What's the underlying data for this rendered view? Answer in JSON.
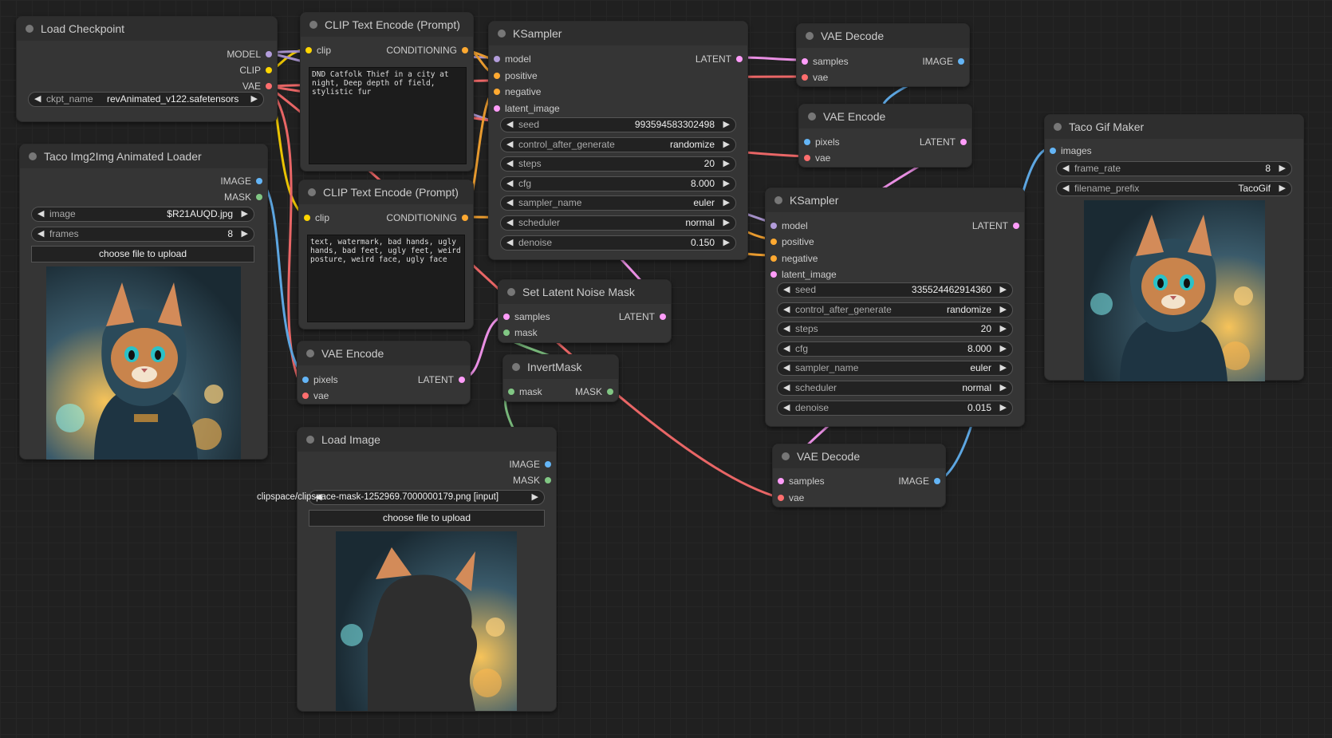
{
  "colors": {
    "model": "#b39ddb",
    "clip": "#ffd500",
    "vae": "#ff6e6e",
    "conditioning": "#ffa931",
    "latent": "#ff9cf9",
    "image": "#64b5f6",
    "mask": "#81c784"
  },
  "nodes": {
    "load_checkpoint": {
      "title": "Load Checkpoint",
      "outputs": [
        "MODEL",
        "CLIP",
        "VAE"
      ],
      "ckpt_label": "ckpt_name",
      "ckpt_value": "revAnimated_v122.safetensors"
    },
    "clip_pos": {
      "title": "CLIP Text Encode (Prompt)",
      "input": "clip",
      "output": "CONDITIONING",
      "text": "DND Catfolk Thief in a city at night, Deep depth of field, stylistic fur"
    },
    "clip_neg": {
      "title": "CLIP Text Encode (Prompt)",
      "input": "clip",
      "output": "CONDITIONING",
      "text": "text, watermark, bad hands, ugly hands, bad feet, ugly feet, weird posture, weird face, ugly face"
    },
    "ksampler1": {
      "title": "KSampler",
      "inputs": [
        "model",
        "positive",
        "negative",
        "latent_image"
      ],
      "output": "LATENT",
      "widgets": [
        {
          "label": "seed",
          "value": "993594583302498"
        },
        {
          "label": "control_after_generate",
          "value": "randomize"
        },
        {
          "label": "steps",
          "value": "20"
        },
        {
          "label": "cfg",
          "value": "8.000"
        },
        {
          "label": "sampler_name",
          "value": "euler"
        },
        {
          "label": "scheduler",
          "value": "normal"
        },
        {
          "label": "denoise",
          "value": "0.150"
        }
      ]
    },
    "vae_decode1": {
      "title": "VAE Decode",
      "inputs": [
        "samples",
        "vae"
      ],
      "output": "IMAGE"
    },
    "vae_encode_top": {
      "title": "VAE Encode",
      "inputs": [
        "pixels",
        "vae"
      ],
      "output": "LATENT"
    },
    "taco_loader": {
      "title": "Taco Img2Img Animated Loader",
      "outputs": [
        "IMAGE",
        "MASK"
      ],
      "widgets": [
        {
          "label": "image",
          "value": "$R21AUQD.jpg"
        },
        {
          "label": "frames",
          "value": "8"
        }
      ],
      "upload_label": "choose file to upload"
    },
    "vae_encode_mid": {
      "title": "VAE Encode",
      "inputs": [
        "pixels",
        "vae"
      ],
      "output": "LATENT"
    },
    "load_image": {
      "title": "Load Image",
      "outputs": [
        "IMAGE",
        "MASK"
      ],
      "image_value": "clipspace/clipspace-mask-1252969.7000000179.png [input]",
      "upload_label": "choose file to upload"
    },
    "set_latent_noise_mask": {
      "title": "Set Latent Noise Mask",
      "inputs": [
        "samples",
        "mask"
      ],
      "output": "LATENT"
    },
    "invert_mask": {
      "title": "InvertMask",
      "input": "mask",
      "output": "MASK"
    },
    "ksampler2": {
      "title": "KSampler",
      "inputs": [
        "model",
        "positive",
        "negative",
        "latent_image"
      ],
      "output": "LATENT",
      "widgets": [
        {
          "label": "seed",
          "value": "335524462914360"
        },
        {
          "label": "control_after_generate",
          "value": "randomize"
        },
        {
          "label": "steps",
          "value": "20"
        },
        {
          "label": "cfg",
          "value": "8.000"
        },
        {
          "label": "sampler_name",
          "value": "euler"
        },
        {
          "label": "scheduler",
          "value": "normal"
        },
        {
          "label": "denoise",
          "value": "0.015"
        }
      ]
    },
    "vae_decode2": {
      "title": "VAE Decode",
      "inputs": [
        "samples",
        "vae"
      ],
      "output": "IMAGE"
    },
    "taco_gif": {
      "title": "Taco Gif Maker",
      "input": "images",
      "widgets": [
        {
          "label": "frame_rate",
          "value": "8"
        },
        {
          "label": "filename_prefix",
          "value": "TacoGif"
        }
      ]
    }
  }
}
